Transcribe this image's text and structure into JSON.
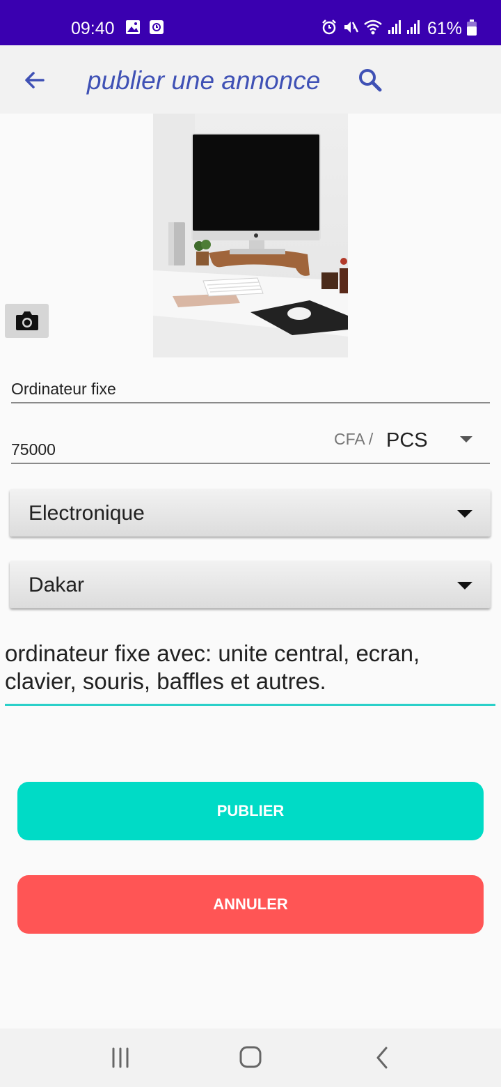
{
  "status_bar": {
    "time": "09:40",
    "battery": "61%"
  },
  "toolbar": {
    "title": "publier une annonce"
  },
  "form": {
    "title_value": "Ordinateur fixe",
    "price_value": "75000",
    "currency_label": "CFA /",
    "unit_selected": "PCS",
    "category_selected": "Electronique",
    "city_selected": "Dakar",
    "description": "ordinateur fixe avec: unite central, ecran, clavier, souris, baffles et autres."
  },
  "buttons": {
    "publish": "PUBLIER",
    "cancel": "ANNULER"
  },
  "colors": {
    "status_bar": "#3a00b0",
    "title": "#3f51b5",
    "publish": "#00dbc6",
    "cancel": "#ff5555",
    "accent_underline": "#2bd0c9"
  },
  "icons": {
    "back": "arrow-left-icon",
    "search": "search-icon",
    "camera": "camera-icon",
    "nav_recents": "recents-icon",
    "nav_home": "home-icon",
    "nav_back": "nav-back-icon"
  }
}
